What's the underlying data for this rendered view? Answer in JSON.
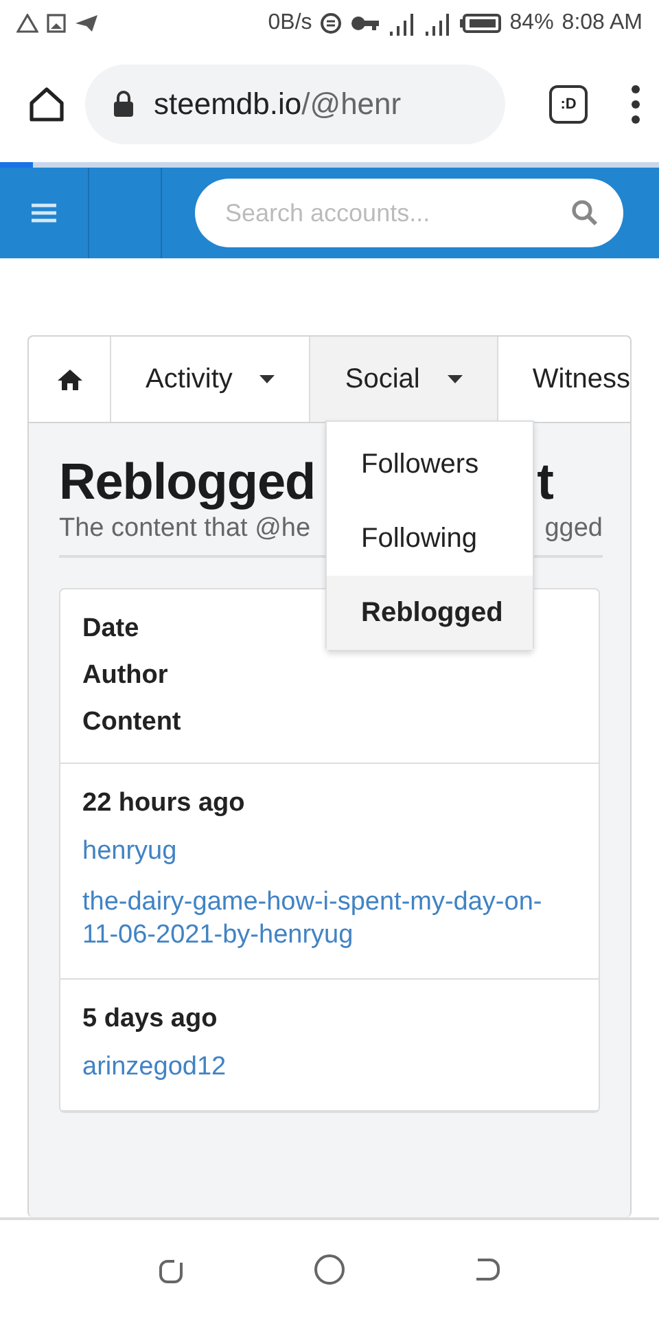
{
  "status_bar": {
    "speed": "0B/s",
    "battery": "84%",
    "time": "8:08 AM"
  },
  "browser": {
    "url_host": "steemdb.io",
    "url_path": "/@henr",
    "tab_count": ":D",
    "load_progress": {
      "level": 0.05
    }
  },
  "header": {
    "search": {
      "placeholder": "Search accounts..."
    }
  },
  "nav_tabs": [
    {
      "kind": "icon",
      "selected": false
    },
    {
      "kind": "dropdown",
      "label": "Activity",
      "selected": false
    },
    {
      "kind": "dropdown",
      "label": "Social",
      "selected": true
    },
    {
      "kind": "text",
      "label": "Witness",
      "selected": false
    }
  ],
  "dropdown": {
    "items": [
      {
        "label": "Followers",
        "selected": false
      },
      {
        "label": "Following",
        "selected": false
      },
      {
        "label": "Reblogged",
        "selected": true
      }
    ]
  },
  "page_title": {
    "before": "Reblogged",
    "after": "t"
  },
  "page_subtitle": {
    "before": "The content that @he",
    "after": "gged"
  },
  "table": {
    "columns": [
      "Date",
      "Author",
      "Content"
    ],
    "rows": [
      {
        "date": "22 hours ago",
        "author": "henryug",
        "content": "the-dairy-game-how-i-spent-my-day-on-11-06-2021-by-henryug"
      },
      {
        "date": "5 days ago",
        "author": "arinzegod12"
      }
    ]
  }
}
